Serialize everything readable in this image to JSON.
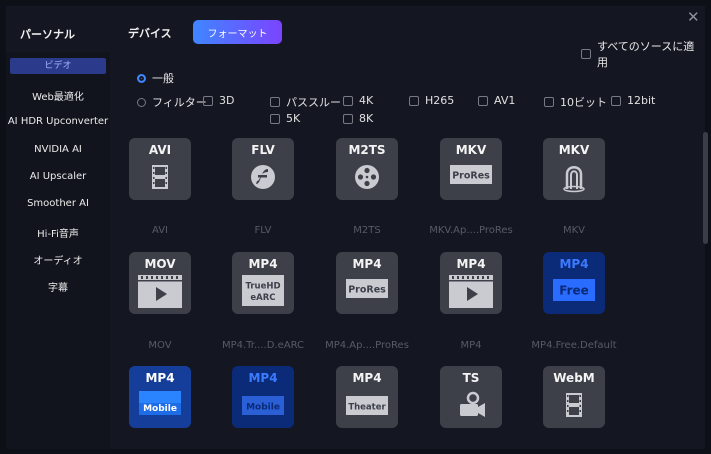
{
  "header": {
    "tabs": [
      "パーソナル",
      "デバイス",
      "フォーマット"
    ],
    "active_tab": "フォーマット",
    "close_glyph": "✕",
    "apply_all_label": "すべてのソースに適用",
    "accent_gradient": [
      "#3f86ff",
      "#7b44ff"
    ]
  },
  "sidebar": {
    "items": [
      "ビデオ",
      "Web最適化",
      "AI HDR Upconverter",
      "NVIDIA AI",
      "AI Upscaler",
      "Smoother AI",
      "Hi-Fi音声",
      "オーディオ",
      "字幕"
    ],
    "active_item": "ビデオ"
  },
  "options": {
    "general_label": "一般",
    "filter_label": "フィルター",
    "general_selected": true,
    "filters": [
      "3D",
      "パススルー",
      "4K",
      "H265",
      "AV1",
      "10ビット",
      "12bit",
      "5K",
      "8K"
    ]
  },
  "formats": [
    {
      "label": "AVI",
      "caption": "AVI",
      "icon": "film-strip-icon",
      "badge": ""
    },
    {
      "label": "FLV",
      "caption": "FLV",
      "icon": "flash-icon",
      "badge": ""
    },
    {
      "label": "M2TS",
      "caption": "M2TS",
      "icon": "film-reel-icon",
      "badge": ""
    },
    {
      "label": "MKV",
      "caption": "MKV.Ap....ProRes",
      "icon": "badge-icon",
      "badge": "ProRes"
    },
    {
      "label": "MKV",
      "caption": "MKV",
      "icon": "matroska-icon",
      "badge": ""
    },
    {
      "label": "MOV",
      "caption": "MOV",
      "icon": "play-icon",
      "badge": ""
    },
    {
      "label": "MP4",
      "caption": "MP4.Tr....D.eARC",
      "icon": "badge-icon",
      "badge": "TrueHD eARC"
    },
    {
      "label": "MP4",
      "caption": "MP4.Ap....ProRes",
      "icon": "badge-icon",
      "badge": "ProRes"
    },
    {
      "label": "MP4",
      "caption": "MP4",
      "icon": "play-icon",
      "badge": ""
    },
    {
      "label": "MP4",
      "caption": "MP4.Free.Default",
      "icon": "badge-icon",
      "badge": "Free"
    },
    {
      "label": "MP4",
      "caption": "",
      "icon": "badge-icon",
      "badge": "Mobile"
    },
    {
      "label": "MP4",
      "caption": "",
      "icon": "badge-icon",
      "badge": "Mobile"
    },
    {
      "label": "MP4",
      "caption": "",
      "icon": "badge-icon",
      "badge": "Theater"
    },
    {
      "label": "TS",
      "caption": "",
      "icon": "camera-icon",
      "badge": ""
    },
    {
      "label": "WebM",
      "caption": "",
      "icon": "film-strip-icon",
      "badge": ""
    }
  ]
}
